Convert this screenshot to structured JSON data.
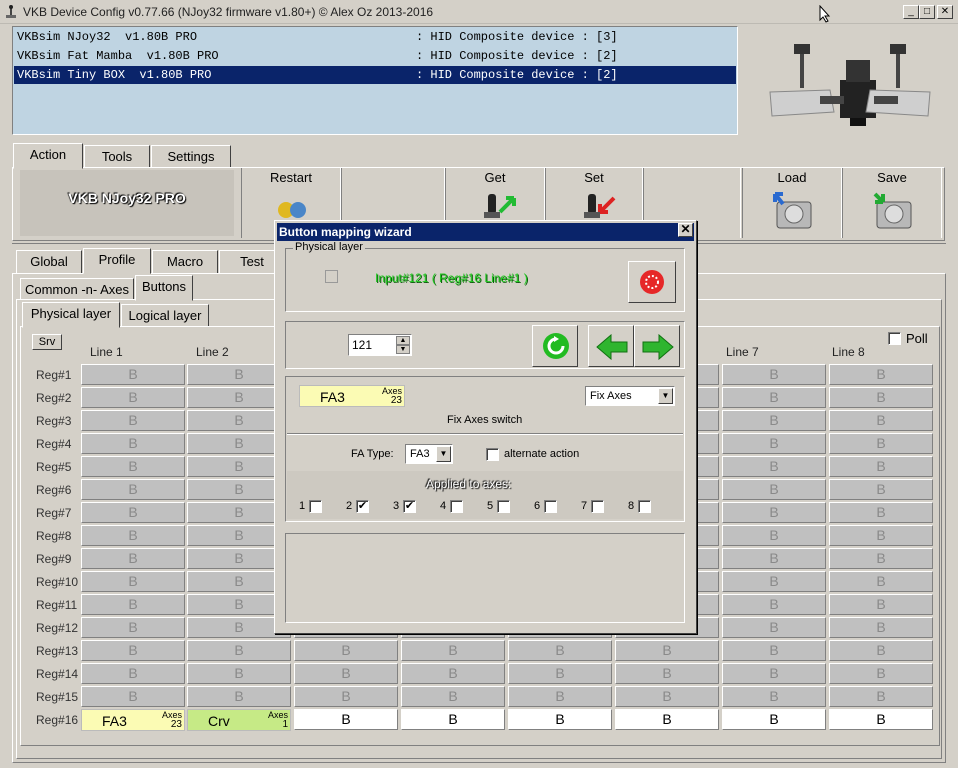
{
  "window": {
    "title": "VKB Device Config v0.77.66 (NJoy32 firmware v1.80+) © Alex Oz 2013-2016"
  },
  "devices": [
    {
      "name": "VKBsim NJoy32  v1.80B PRO",
      "status": ": HID Composite device : [3]"
    },
    {
      "name": "VKBsim Fat Mamba  v1.80B PRO",
      "status": ": HID Composite device : [2]"
    },
    {
      "name": "VKBsim Tiny BOX  v1.80B PRO",
      "status": ": HID Composite device : [2]"
    }
  ],
  "main_tabs": [
    "Action",
    "Tools",
    "Settings"
  ],
  "device_name": "VKB NJoy32 PRO",
  "toolbar": {
    "restart": "Restart",
    "get": "Get",
    "set": "Set",
    "load": "Load",
    "save": "Save"
  },
  "sub_tabs": [
    "Global",
    "Profile",
    "Macro",
    "Test"
  ],
  "profile_tabs": [
    "Common -n- Axes",
    "Buttons"
  ],
  "layer_tabs": [
    "Physical layer",
    "Logical layer"
  ],
  "grid": {
    "srv_label": "Srv",
    "poll_label": "Poll",
    "columns": [
      "Line 1",
      "Line 2",
      "Line 7",
      "Line 8"
    ],
    "rows": [
      "Reg#1",
      "Reg#2",
      "Reg#3",
      "Reg#4",
      "Reg#5",
      "Reg#6",
      "Reg#7",
      "Reg#8",
      "Reg#9",
      "Reg#10",
      "Reg#11",
      "Reg#12",
      "Reg#13",
      "Reg#14",
      "Reg#15",
      "Reg#16"
    ],
    "cell_text": "B",
    "last_row": {
      "c1_main": "FA3",
      "c1_sup": "Axes",
      "c1_sub": "23",
      "c2_main": "Crv",
      "c2_sup": "Axes",
      "c2_sub": "1"
    }
  },
  "dialog": {
    "title": "Button mapping wizard",
    "physical_layer_label": "Physical layer",
    "input_text": "Input#121  ( Reg#16  Line#1 )",
    "spin_value": "121",
    "fa_value_main": "FA3",
    "fa_value_sup": "Axes",
    "fa_value_sub": "23",
    "function_select": "Fix Axes",
    "function_desc": "Fix Axes switch",
    "fa_type_label": "FA Type:",
    "fa_type_value": "FA3",
    "alternate_action_label": "alternate action",
    "applied_to_axes_label": "Applied to axes:",
    "axes": [
      {
        "n": "1",
        "checked": false
      },
      {
        "n": "2",
        "checked": true
      },
      {
        "n": "3",
        "checked": true
      },
      {
        "n": "4",
        "checked": false
      },
      {
        "n": "5",
        "checked": false
      },
      {
        "n": "6",
        "checked": false
      },
      {
        "n": "7",
        "checked": false
      },
      {
        "n": "8",
        "checked": false
      }
    ],
    "check_mark": "✔"
  },
  "colors": {
    "selection": "#0a246a",
    "list_bg": "#bfd4e2",
    "fa_cell": "#fbfbb4",
    "crv_cell": "#c6ea86",
    "input_green": "#22cc22"
  }
}
